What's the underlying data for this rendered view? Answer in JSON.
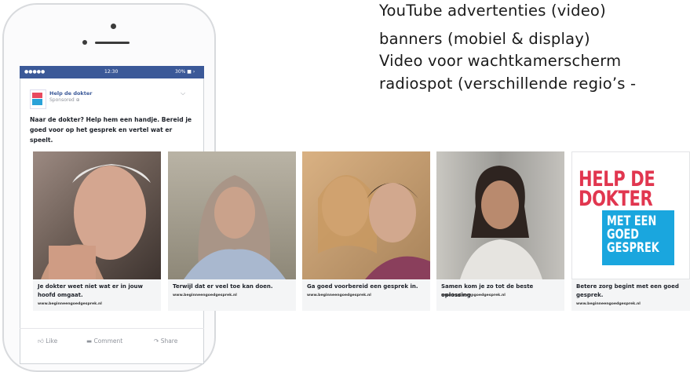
{
  "right_lines": [
    "YouTube advertenties (video)",
    "banners (mobiel & display)",
    "Video voor wachtkamerscherm",
    "radiospot (verschillende regio’s -"
  ],
  "phone": {
    "status": {
      "carrier": "●●●●●",
      "time": "12:30",
      "battery": "30% ■ ›"
    },
    "page_name": "Help de dokter",
    "sponsored": "Sponsored ⊕",
    "post_text": "Naar de dokter? Help hem een handje. Bereid je goed voor op het gesprek en vertel wat er speelt.",
    "actions": {
      "like": "Like",
      "comment": "Comment",
      "share": "Share"
    }
  },
  "cards": [
    {
      "caption": "Je dokter weet niet wat er in jouw hoofd omgaat.",
      "url": "www.beginneengoedgesprek.nl"
    },
    {
      "caption": "Terwijl dat er veel toe kan doen.",
      "url": "www.beginneengoedgesprek.nl"
    },
    {
      "caption": "Ga goed voorbereid een gesprek in.",
      "url": "www.beginneengoedgesprek.nl"
    },
    {
      "caption": "Samen kom je zo tot de beste oplossing.",
      "url": "www.beginneengoedgesprek.nl"
    },
    {
      "caption": "Betere zorg begint met een goed gesprek.",
      "url": "www.beginneengoedgesprek.nl"
    }
  ],
  "brand_logo": {
    "line1": "HELP DE",
    "line2": "DOKTER",
    "box_lines": [
      "MET EEN",
      "GOED",
      "GESPREK"
    ]
  },
  "colors": {
    "facebook_blue": "#3b5998",
    "brand_red": "#e1364f",
    "brand_cyan": "#1aa6de"
  }
}
